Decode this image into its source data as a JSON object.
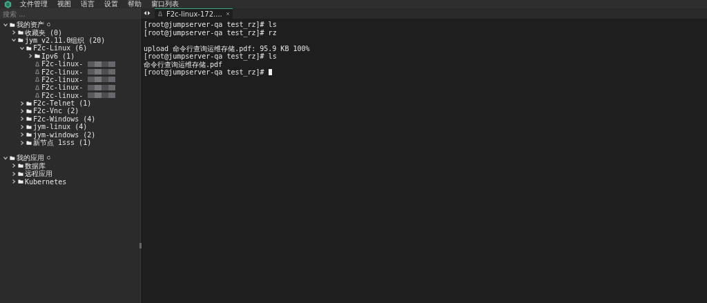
{
  "menu": [
    "文件管理",
    "视图",
    "语言",
    "设置",
    "帮助",
    "窗口列表"
  ],
  "search": {
    "placeholder": "搜索 ..."
  },
  "tree": [
    {
      "label": "我的资产",
      "kind": "root",
      "expanded": true,
      "children": [
        {
          "label": "收藏夹 (0)",
          "kind": "folder",
          "expanded": false
        },
        {
          "label": "jym_v2.11.0组织 (20)",
          "kind": "folder",
          "expanded": true,
          "children": [
            {
              "label": "F2c-Linux (6)",
              "kind": "folder",
              "expanded": true,
              "children": [
                {
                  "label": "Ipv6 (1)",
                  "kind": "folder",
                  "expanded": false
                },
                {
                  "label": "F2c-linux-",
                  "kind": "host"
                },
                {
                  "label": "F2c-linux-",
                  "kind": "host"
                },
                {
                  "label": "F2c-linux-",
                  "kind": "host"
                },
                {
                  "label": "F2c-linux-",
                  "kind": "host"
                },
                {
                  "label": "F2c-linux-",
                  "kind": "host"
                }
              ]
            },
            {
              "label": "F2c-Telnet (1)",
              "kind": "folder",
              "expanded": false
            },
            {
              "label": "F2c-Vnc (2)",
              "kind": "folder",
              "expanded": false
            },
            {
              "label": "F2c-Windows (4)",
              "kind": "folder",
              "expanded": false
            },
            {
              "label": "jym-linux (4)",
              "kind": "folder",
              "expanded": false
            },
            {
              "label": "jym-windows (2)",
              "kind": "folder",
              "expanded": false
            },
            {
              "label": "新节点 1sss (1)",
              "kind": "folder",
              "expanded": false
            }
          ]
        }
      ]
    },
    {
      "label": "我的应用",
      "kind": "root",
      "expanded": true,
      "children": [
        {
          "label": "数据库",
          "kind": "folder",
          "expanded": false
        },
        {
          "label": "远程应用",
          "kind": "folder",
          "expanded": false
        },
        {
          "label": "Kubernetes",
          "kind": "folder",
          "expanded": false
        }
      ]
    }
  ],
  "tabs": [
    {
      "label": "F2c-linux-172....",
      "selected": true
    }
  ],
  "terminal": {
    "lines": [
      {
        "text": "[root@jumpserver-qa test_rz]# ls"
      },
      {
        "text": "[root@jumpserver-qa test_rz]# rz"
      },
      {
        "text": "upload 命令行查询运维存储.pdf: 95.9 KB 100%",
        "blank_before": true
      },
      {
        "text": "[root@jumpserver-qa test_rz]# ls"
      },
      {
        "text": "命令行查询运维存储.pdf"
      },
      {
        "text": "[root@jumpserver-qa test_rz]# "
      }
    ],
    "cursor": true
  }
}
